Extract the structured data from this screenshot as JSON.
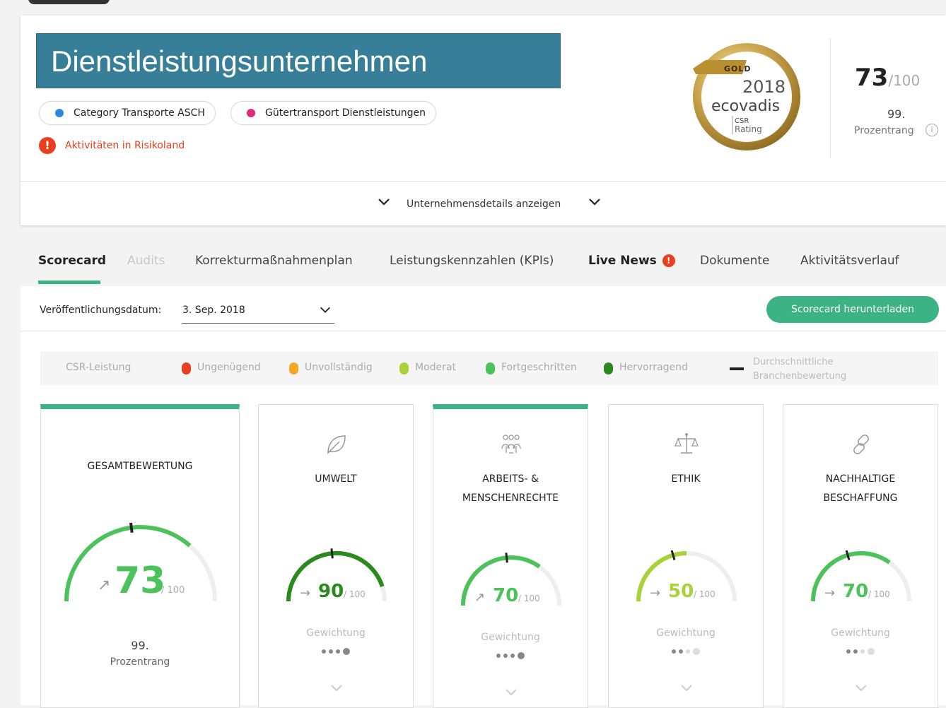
{
  "company": {
    "name": "Dienstleistungsunternehmen",
    "categories": [
      {
        "label": "Category Transporte ASCH",
        "color": "#2e86de"
      },
      {
        "label": "Gütertransport Dienstleistungen",
        "color": "#e6267a"
      }
    ],
    "risk_label": "Aktivitäten in Risikoland",
    "risk_icon": "!"
  },
  "badge": {
    "level": "GOLD",
    "year": "2018",
    "brand": "ecovadis",
    "csr": "CSR",
    "rating": "Rating"
  },
  "summary": {
    "score": "73",
    "score_of": "/100",
    "rank": "99.",
    "rank_label": "Prozentrang",
    "info_icon": "i"
  },
  "details_toggle": "Unternehmensdetails anzeigen",
  "tabs": [
    {
      "label": "Scorecard",
      "state": "active"
    },
    {
      "label": "Audits",
      "state": "disabled"
    },
    {
      "label": "Korrekturmaßnahmenplan",
      "state": "normal"
    },
    {
      "label": "Leistungskennzahlen (KPIs)",
      "state": "normal"
    },
    {
      "label": "Live News",
      "state": "bold",
      "alert": "!"
    },
    {
      "label": "Dokumente",
      "state": "normal"
    },
    {
      "label": "Aktivitätsverlauf",
      "state": "normal"
    }
  ],
  "publication": {
    "label": "Veröffentlichungsdatum:",
    "value": "3. Sep. 2018"
  },
  "download_button": "Scorecard herunterladen",
  "legend": {
    "title": "CSR-Leistung",
    "items": [
      {
        "label": "Ungenügend",
        "color": "#e8401f"
      },
      {
        "label": "Unvollständig",
        "color": "#f5a623"
      },
      {
        "label": "Moderat",
        "color": "#a8d23a"
      },
      {
        "label": "Fortgeschritten",
        "color": "#4cc35a"
      },
      {
        "label": "Hervorragend",
        "color": "#2b8a1e"
      }
    ],
    "average_line1": "Durchschnittliche",
    "average_line2": "Branchenbewertung"
  },
  "cards": [
    {
      "title_lines": [
        "GESAMTBEWERTUNG"
      ],
      "icon": "none",
      "score": "73",
      "score_value": 73,
      "of": "/ 100",
      "trend": "↗",
      "color": "#4cc35a",
      "rank": "99.",
      "rank_label": "Prozentrang",
      "topbar": true
    },
    {
      "title_lines": [
        "UMWELT"
      ],
      "icon": "leaf-icon",
      "score": "90",
      "score_value": 90,
      "of": "/ 100",
      "trend": "→",
      "color": "#2b8a1e",
      "weight_label": "Gewichtung",
      "weight": 4,
      "topbar": false
    },
    {
      "title_lines": [
        "ARBEITS- &",
        "MENSCHENRECHTE"
      ],
      "icon": "people-icon",
      "score": "70",
      "score_value": 70,
      "of": "/ 100",
      "trend": "↗",
      "color": "#4cc35a",
      "weight_label": "Gewichtung",
      "weight": 4,
      "topbar": true
    },
    {
      "title_lines": [
        "ETHIK"
      ],
      "icon": "scales-icon",
      "score": "50",
      "score_value": 50,
      "of": "/ 100",
      "trend": "→",
      "color": "#a8d23a",
      "weight_label": "Gewichtung",
      "weight": 2,
      "topbar": false
    },
    {
      "title_lines": [
        "NACHHALTIGE",
        "BESCHAFFUNG"
      ],
      "icon": "link-icon",
      "score": "70",
      "score_value": 70,
      "of": "/ 100",
      "trend": "→",
      "color": "#4cc35a",
      "weight_label": "Gewichtung",
      "weight": 2,
      "topbar": false
    }
  ]
}
